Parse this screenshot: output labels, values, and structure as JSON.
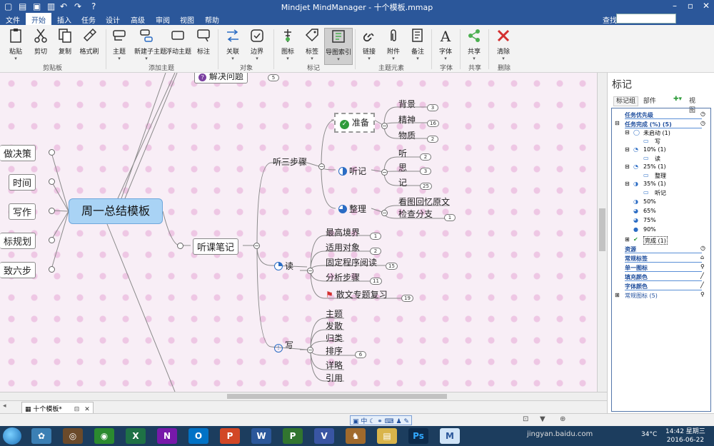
{
  "window": {
    "title": "Mindjet MindManager - 十个模板.mmap",
    "help_button": "?"
  },
  "menu": {
    "items": [
      "文件",
      "开始",
      "插入",
      "任务",
      "设计",
      "高级",
      "审阅",
      "视图",
      "帮助"
    ],
    "active": "开始",
    "search_label": "查找:"
  },
  "ribbon": {
    "buttons": [
      "粘贴",
      "剪切",
      "复制",
      "格式刷",
      "主题",
      "新建子主题",
      "浮动主题",
      "标注",
      "关联",
      "边界",
      "图标",
      "标签",
      "导图索引",
      "链接",
      "附件",
      "备注",
      "字体",
      "共享",
      "清除"
    ],
    "groups": [
      "剪贴板",
      "添加主题",
      "对象",
      "标记",
      "主题元素",
      "字体",
      "共享",
      "删除"
    ]
  },
  "map": {
    "central": "周一总结模板",
    "partial_top": {
      "label": "解决问题",
      "count": "5"
    },
    "left_nodes": [
      "做决策",
      "时间",
      "写作",
      "标规划",
      "致六步"
    ],
    "main_branch": "听课笔记",
    "steps": {
      "label": "听三步骤",
      "prepare": {
        "label": "准备",
        "children": [
          {
            "label": "背景",
            "count": "3"
          },
          {
            "label": "精神",
            "count": "16"
          },
          {
            "label": "物质",
            "count": "2"
          }
        ]
      },
      "listen": {
        "label": "听记",
        "children": [
          {
            "label": "听",
            "count": "2"
          },
          {
            "label": "思",
            "count": "3"
          },
          {
            "label": "记",
            "count": "25"
          }
        ]
      },
      "organize": {
        "label": "整理",
        "children": [
          {
            "label": "看图回忆原文",
            "count": ""
          },
          {
            "label": "检查分支",
            "count": "1"
          }
        ]
      }
    },
    "read": {
      "label": "读",
      "children": [
        {
          "label": "最高境界",
          "count": "1"
        },
        {
          "label": "适用对象",
          "count": "2"
        },
        {
          "label": "固定程序阅读",
          "count": "15"
        },
        {
          "label": "分析步骤",
          "count": "11"
        },
        {
          "label": "散文专题复习",
          "count": "19"
        }
      ]
    },
    "write": {
      "label": "写",
      "children": [
        "主题",
        "发散",
        "归类",
        "排序",
        "详略",
        "引用"
      ],
      "count": "6"
    }
  },
  "document_tab": {
    "label": "十个模板*"
  },
  "panel": {
    "title": "标记",
    "tabs": [
      "标记组",
      "部件"
    ],
    "view_label": "视图",
    "tree": [
      {
        "label": "任务优先级",
        "style": "blue"
      },
      {
        "label": "任务完成 (%) (5)",
        "style": "blue"
      },
      {
        "label": "未启动 (1)",
        "style": "normal"
      },
      {
        "label": "写",
        "style": "child"
      },
      {
        "label": "10% (1)",
        "style": "normal"
      },
      {
        "label": "读",
        "style": "child"
      },
      {
        "label": "25% (1)",
        "style": "normal"
      },
      {
        "label": "整理",
        "style": "child"
      },
      {
        "label": "35% (1)",
        "style": "normal"
      },
      {
        "label": "听记",
        "style": "child"
      },
      {
        "label": "50%",
        "style": "normal"
      },
      {
        "label": "65%",
        "style": "normal"
      },
      {
        "label": "75%",
        "style": "normal"
      },
      {
        "label": "90%",
        "style": "normal"
      },
      {
        "label": "完成 (1)",
        "style": "normal"
      },
      {
        "label": "资源",
        "style": "blue"
      },
      {
        "label": "常规标签",
        "style": "blue"
      },
      {
        "label": "单一图标",
        "style": "blue"
      },
      {
        "label": "填充颜色",
        "style": "blue"
      },
      {
        "label": "字体颜色",
        "style": "blue"
      },
      {
        "label": "常规图标 (5)",
        "style": "normal"
      }
    ]
  },
  "taskbar": {
    "clock_time": "14:42 星期三",
    "clock_date": "2016-06-22",
    "temperature": "34°C",
    "watermark": "jingyan.baidu.com"
  },
  "colors": {
    "accent": "#2b579a",
    "central_fill": "#a9d3f5",
    "canvas": "#f8eef6"
  }
}
